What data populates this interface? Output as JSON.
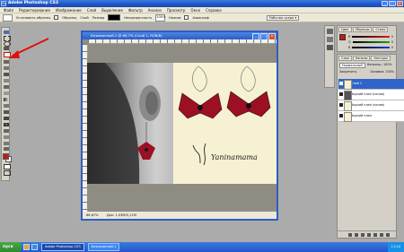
{
  "app": {
    "title": "Adobe Photoshop CS3",
    "logo": "Ps",
    "window_buttons": [
      "_",
      "□",
      "×"
    ]
  },
  "menu": [
    "Файл",
    "Редактирование",
    "Изображение",
    "Слой",
    "Выделение",
    "Фильтр",
    "Анализ",
    "Просмотр",
    "Окно",
    "Справка"
  ],
  "options": {
    "items": [
      "Установить образец",
      "Образец",
      "Слой",
      "Размер",
      "Непрозрачность",
      "Нажим",
      "Аэрограф",
      "Рабочая среда"
    ],
    "opacity": "100%",
    "workspace": "Рабочая среда ▾"
  },
  "document": {
    "title": "Безымянный-1 @ 66,7% (Слой 1, RGB/8)",
    "status": "Док: 1,03М/5,11М",
    "zoom": "66,67%",
    "watermark": "Yaninamama"
  },
  "panels": {
    "color_tabs": [
      "Цвет",
      "Образцы",
      "Стили"
    ],
    "channels": [
      {
        "label": "R",
        "value": "0",
        "color": "#d81e1e"
      },
      {
        "label": "G",
        "value": "0",
        "color": "#1ea31e"
      },
      {
        "label": "B",
        "value": "0",
        "color": "#1e3ad8"
      }
    ],
    "layers_tabs": [
      "Слои",
      "Каналы",
      "Контуры"
    ],
    "blend_mode": "Нормальный",
    "opacity_label": "Непрозр.: 100%",
    "lock_label": "Закрепить:",
    "fill_label": "Заливка: 100%",
    "layers": [
      {
        "name": "Слой 1",
        "selected": true
      },
      {
        "name": "Задний план (копия)",
        "selected": false
      },
      {
        "name": "Задний план (копия)",
        "selected": false
      },
      {
        "name": "Задний план",
        "selected": false
      }
    ]
  },
  "taskbar": {
    "start": "пуск",
    "buttons": [
      "Adobe Photoshop CS3",
      "Безымянный-1"
    ],
    "clock": "11:24"
  },
  "colors": {
    "foreground": "#c41a12",
    "background": "#ffffff",
    "accent": "#2f64c9",
    "arrow": "#e01010",
    "earring": "#9b1024"
  }
}
